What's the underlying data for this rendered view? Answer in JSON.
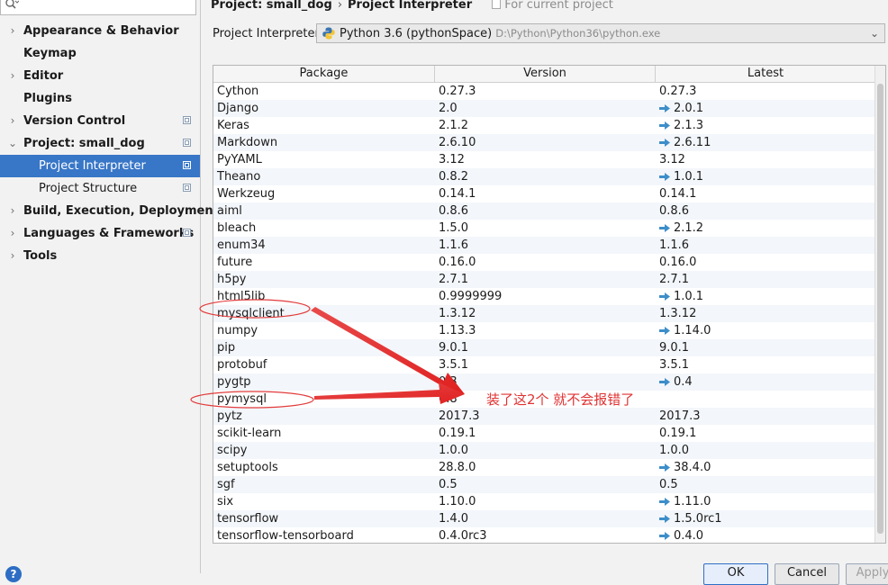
{
  "sidebar": {
    "search_placeholder": "",
    "items": [
      {
        "label": "Appearance & Behavior",
        "arrow": "›",
        "bold": true,
        "indent": 26,
        "config": false,
        "selected": false
      },
      {
        "label": "Keymap",
        "arrow": "",
        "bold": true,
        "indent": 26,
        "config": false,
        "selected": false
      },
      {
        "label": "Editor",
        "arrow": "›",
        "bold": true,
        "indent": 26,
        "config": false,
        "selected": false
      },
      {
        "label": "Plugins",
        "arrow": "",
        "bold": true,
        "indent": 26,
        "config": false,
        "selected": false
      },
      {
        "label": "Version Control",
        "arrow": "›",
        "bold": true,
        "indent": 26,
        "config": true,
        "selected": false
      },
      {
        "label": "Project: small_dog",
        "arrow": "⌄",
        "bold": true,
        "indent": 26,
        "config": true,
        "selected": false
      },
      {
        "label": "Project Interpreter",
        "arrow": "",
        "bold": false,
        "indent": 43,
        "config": true,
        "selected": true
      },
      {
        "label": "Project Structure",
        "arrow": "",
        "bold": false,
        "indent": 43,
        "config": true,
        "selected": false
      },
      {
        "label": "Build, Execution, Deployment",
        "arrow": "›",
        "bold": true,
        "indent": 26,
        "config": false,
        "selected": false
      },
      {
        "label": "Languages & Frameworks",
        "arrow": "›",
        "bold": true,
        "indent": 26,
        "config": true,
        "selected": false
      },
      {
        "label": "Tools",
        "arrow": "›",
        "bold": true,
        "indent": 26,
        "config": false,
        "selected": false
      }
    ]
  },
  "header": {
    "crumb1": "Project: small_dog",
    "separator": "›",
    "crumb2": "Project Interpreter",
    "for_current": "For current project"
  },
  "interpreter": {
    "label": "Project Interpreter:",
    "name": "Python 3.6 (pythonSpace)",
    "path": "D:\\Python\\Python36\\python.exe"
  },
  "table": {
    "columns": [
      "Package",
      "Version",
      "Latest"
    ],
    "rows": [
      {
        "package": "Cython",
        "version": "0.27.3",
        "latest": "0.27.3",
        "upgrade": false
      },
      {
        "package": "Django",
        "version": "2.0",
        "latest": "2.0.1",
        "upgrade": true
      },
      {
        "package": "Keras",
        "version": "2.1.2",
        "latest": "2.1.3",
        "upgrade": true
      },
      {
        "package": "Markdown",
        "version": "2.6.10",
        "latest": "2.6.11",
        "upgrade": true
      },
      {
        "package": "PyYAML",
        "version": "3.12",
        "latest": "3.12",
        "upgrade": false
      },
      {
        "package": "Theano",
        "version": "0.8.2",
        "latest": "1.0.1",
        "upgrade": true
      },
      {
        "package": "Werkzeug",
        "version": "0.14.1",
        "latest": "0.14.1",
        "upgrade": false
      },
      {
        "package": "aiml",
        "version": "0.8.6",
        "latest": "0.8.6",
        "upgrade": false
      },
      {
        "package": "bleach",
        "version": "1.5.0",
        "latest": "2.1.2",
        "upgrade": true
      },
      {
        "package": "enum34",
        "version": "1.1.6",
        "latest": "1.1.6",
        "upgrade": false
      },
      {
        "package": "future",
        "version": "0.16.0",
        "latest": "0.16.0",
        "upgrade": false
      },
      {
        "package": "h5py",
        "version": "2.7.1",
        "latest": "2.7.1",
        "upgrade": false
      },
      {
        "package": "html5lib",
        "version": "0.9999999",
        "latest": "1.0.1",
        "upgrade": true
      },
      {
        "package": "mysqlclient",
        "version": "1.3.12",
        "latest": "1.3.12",
        "upgrade": false
      },
      {
        "package": "numpy",
        "version": "1.13.3",
        "latest": "1.14.0",
        "upgrade": true
      },
      {
        "package": "pip",
        "version": "9.0.1",
        "latest": "9.0.1",
        "upgrade": false
      },
      {
        "package": "protobuf",
        "version": "3.5.1",
        "latest": "3.5.1",
        "upgrade": false
      },
      {
        "package": "pygtp",
        "version": "0.3",
        "latest": "0.4",
        "upgrade": true
      },
      {
        "package": "pymysql",
        "version": "0.8",
        "latest": "",
        "upgrade": false
      },
      {
        "package": "pytz",
        "version": "2017.3",
        "latest": "2017.3",
        "upgrade": false
      },
      {
        "package": "scikit-learn",
        "version": "0.19.1",
        "latest": "0.19.1",
        "upgrade": false
      },
      {
        "package": "scipy",
        "version": "1.0.0",
        "latest": "1.0.0",
        "upgrade": false
      },
      {
        "package": "setuptools",
        "version": "28.8.0",
        "latest": "38.4.0",
        "upgrade": true
      },
      {
        "package": "sgf",
        "version": "0.5",
        "latest": "0.5",
        "upgrade": false
      },
      {
        "package": "six",
        "version": "1.10.0",
        "latest": "1.11.0",
        "upgrade": true
      },
      {
        "package": "tensorflow",
        "version": "1.4.0",
        "latest": "1.5.0rc1",
        "upgrade": true
      },
      {
        "package": "tensorflow-tensorboard",
        "version": "0.4.0rc3",
        "latest": "0.4.0",
        "upgrade": true
      }
    ]
  },
  "annotation": {
    "text": "装了这2个 就不会报错了",
    "color": "#e03232"
  },
  "buttons": {
    "ok": "OK",
    "cancel": "Cancel",
    "apply": "Apply",
    "help": "?"
  },
  "colors": {
    "selection": "#3876c7",
    "upgrade_arrow": "#3d8ec9"
  },
  "icons": {
    "search": "search-icon",
    "python": "python-icon",
    "upgrade": "upgrade-arrow-icon",
    "config": "project-config-icon"
  }
}
